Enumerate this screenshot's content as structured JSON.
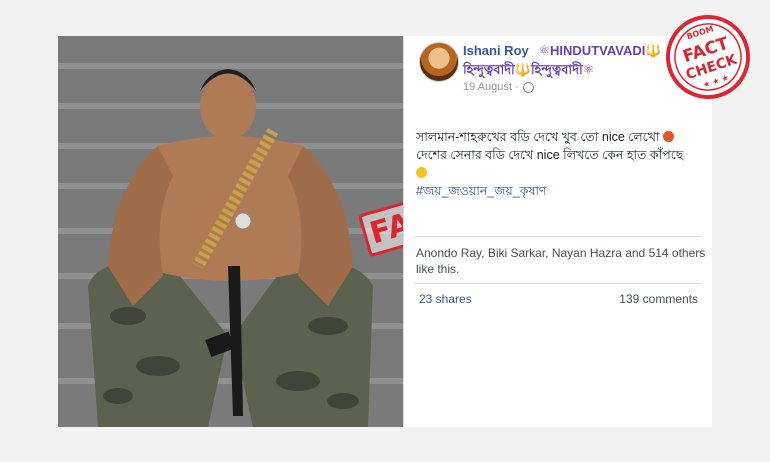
{
  "photo": {
    "stamp_text": "FAKE"
  },
  "post": {
    "author": "Ishani Roy",
    "author_tag": "⚛HINDUTVAVADI🔱",
    "author_line2": "হিন্দুত্ববাদী🔱হিন্দুত্ববাদী⚛",
    "date": "19 August ·",
    "text_line1": "সালমান-শাহরুখের বডি দেখে খুব তো nice লেখো",
    "text_line2": "দেশের সেনার বডি দেখে nice লিখতে কেন হাত কাঁপছে",
    "hashtag": "#জয়_জওয়ান_জয়_কৃষাণ",
    "likes_text": "Anondo Ray, Biki Sarkar, Nayan Hazra and 514 others like this.",
    "shares": "23 shares",
    "comments": "139 comments"
  },
  "badge": {
    "brand": "BOOM",
    "line1": "FACT",
    "line2": "CHECK",
    "color": "#e0232e"
  }
}
